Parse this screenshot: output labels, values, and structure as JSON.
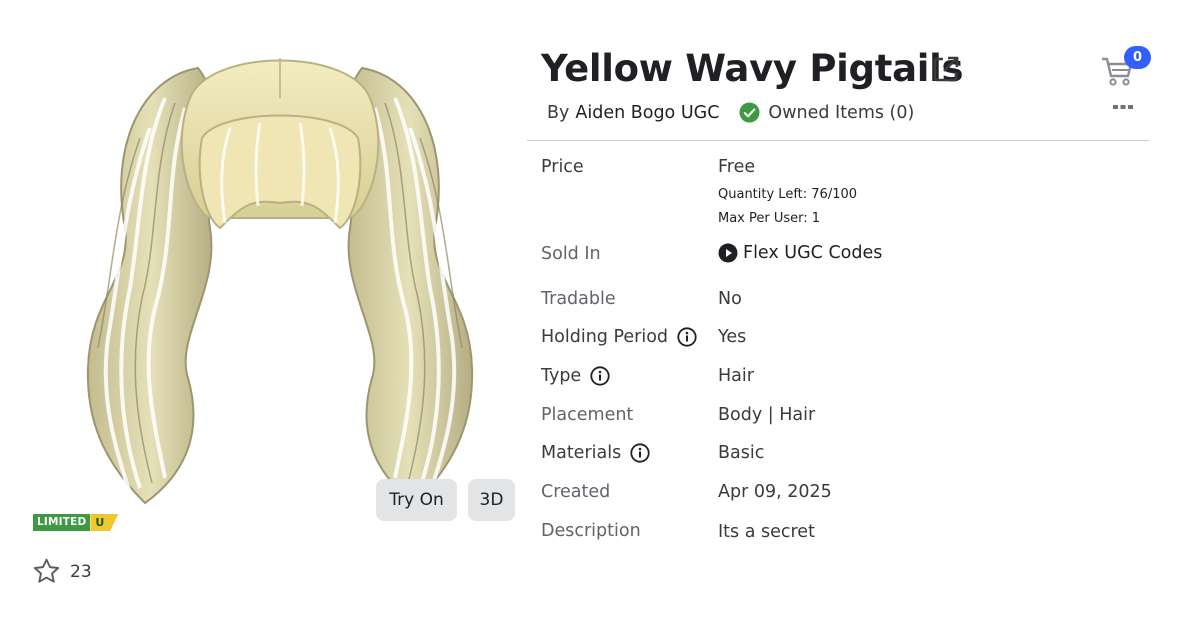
{
  "item": {
    "title": "Yellow Wavy Pigtails",
    "creator_prefix": "By",
    "creator_name": "Aiden Bogo UGC",
    "owned_text": "Owned Items (0)"
  },
  "preview": {
    "try_on_label": "Try On",
    "three_d_label": "3D",
    "limited_label": "LIMITED",
    "limited_u_label": "U",
    "favorite_count": "23"
  },
  "cart": {
    "count": "0"
  },
  "details": {
    "price_label": "Price",
    "price_value": "Free",
    "quantity_left": "Quantity Left: 76/100",
    "max_per_user": "Max Per User: 1",
    "sold_in_label": "Sold In",
    "sold_in_value": "Flex UGC Codes",
    "tradable_label": "Tradable",
    "tradable_value": "No",
    "holding_label": "Holding Period",
    "holding_value": "Yes",
    "type_label": "Type",
    "type_value": "Hair",
    "placement_label": "Placement",
    "placement_value": "Body | Hair",
    "materials_label": "Materials",
    "materials_value": "Basic",
    "created_label": "Created",
    "created_value": "Apr 09, 2025",
    "description_label": "Description",
    "description_value": "Its a secret"
  },
  "icons": {
    "external_link": "external-link-icon",
    "check": "check-circle-icon",
    "cart": "shopping-cart-icon",
    "more": "more-options-icon",
    "info": "info-icon",
    "play": "play-circle-icon",
    "star": "star-outline-icon"
  },
  "colors": {
    "badge_blue": "#335fff",
    "check_green": "#3d9a40",
    "limited_green": "#3d9a40",
    "limited_yellow": "#f2c72d",
    "button_grey": "#e3e4e6"
  }
}
